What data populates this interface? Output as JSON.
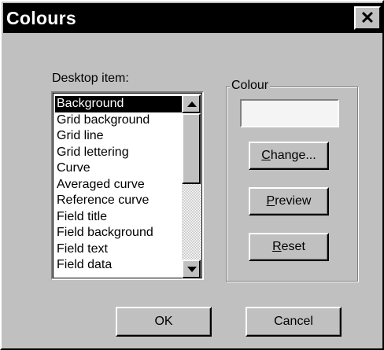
{
  "window": {
    "title": "Colours",
    "close_glyph": "✕"
  },
  "desktop_item": {
    "label": "Desktop item:",
    "items": [
      "Background",
      "Grid background",
      "Grid line",
      "Grid lettering",
      "Curve",
      "Averaged curve",
      "Reference curve",
      "Field title",
      "Field background",
      "Field text",
      "Field data"
    ],
    "selected_index": 0
  },
  "colour": {
    "group_label": "Colour",
    "swatch_color": "#f4f4f4",
    "change": {
      "mnemonic": "C",
      "rest": "hange..."
    },
    "preview": {
      "mnemonic": "P",
      "rest": "review"
    },
    "reset": {
      "mnemonic": "R",
      "rest": "eset"
    }
  },
  "buttons": {
    "ok": "OK",
    "cancel": "Cancel"
  }
}
